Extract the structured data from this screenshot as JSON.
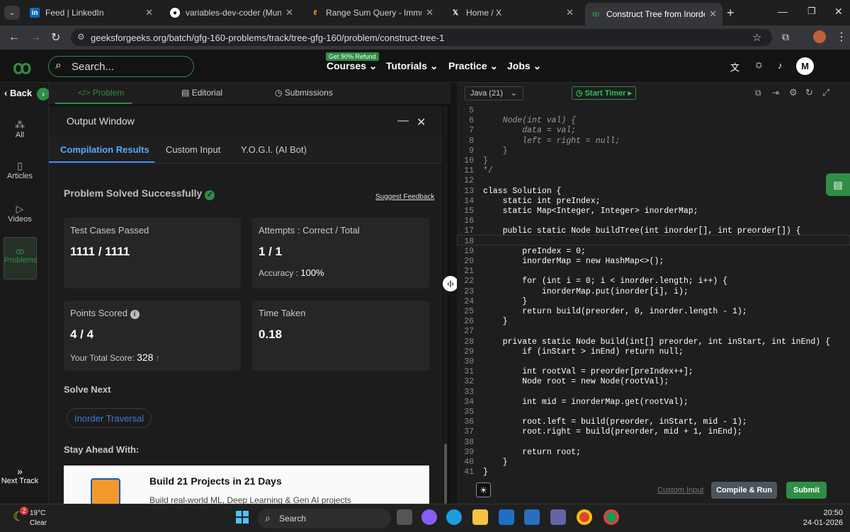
{
  "browser": {
    "tabs": [
      {
        "title": "Feed | LinkedIn",
        "fav": "in",
        "color": "#0a66c2"
      },
      {
        "title": "variables-dev-coder (Munna Az",
        "fav": "gh",
        "color": "#ffffff"
      },
      {
        "title": "Range Sum Query - Immutable",
        "fav": "lc",
        "color": "#ffa116"
      },
      {
        "title": "Home / X",
        "fav": "X",
        "color": "#000000"
      },
      {
        "title": "Construct Tree from Inorder &",
        "fav": "gfg",
        "color": "#2f8d46"
      }
    ],
    "url": "geeksforgeeks.org/batch/gfg-160-problems/track/tree-gfg-160/problem/construct-tree-1"
  },
  "header": {
    "search_placeholder": "Search...",
    "badge": "Get 90% Refund",
    "nav": [
      "Courses",
      "Tutorials",
      "Practice",
      "Jobs"
    ],
    "avatar": "M"
  },
  "rail": {
    "back": "Back",
    "items": [
      "All",
      "Articles",
      "Videos",
      "Problems"
    ],
    "next": "Next Track"
  },
  "problem_tabs": [
    "Problem",
    "Editorial",
    "Submissions"
  ],
  "output": {
    "title": "Output Window",
    "tabs": [
      "Compilation Results",
      "Custom Input",
      "Y.O.G.I. (AI Bot)"
    ],
    "status": "Problem Solved Successfully",
    "feedback": "Suggest Feedback",
    "cards": {
      "tests_label": "Test Cases Passed",
      "tests_value": "1111 / 1111",
      "attempts_label": "Attempts : Correct / Total",
      "attempts_value": "1 / 1",
      "accuracy_label": "Accuracy :",
      "accuracy_value": "100%",
      "points_label": "Points Scored",
      "points_value": "4 / 4",
      "total_label": "Your Total Score:",
      "total_value": "328",
      "time_label": "Time Taken",
      "time_value": "0.18"
    },
    "solve_next": "Solve Next",
    "next_problem": "Inorder Traversal",
    "stay_ahead": "Stay Ahead With:",
    "promo_title": "Build 21 Projects in 21 Days",
    "promo_sub": "Build real-world ML, Deep Learning & Gen AI projects"
  },
  "editor": {
    "language": "Java (21)",
    "timer": "Start Timer",
    "custom_input": "Custom Input",
    "compile": "Compile & Run",
    "submit": "Submit",
    "lines": [
      {
        "n": "5",
        "t": ""
      },
      {
        "n": "6",
        "t": "    Node(int val) {"
      },
      {
        "n": "7",
        "t": "        data = val;"
      },
      {
        "n": "8",
        "t": "        left = right = null;"
      },
      {
        "n": "9",
        "t": "    }"
      },
      {
        "n": "10",
        "t": "}"
      },
      {
        "n": "11",
        "t": "*/"
      },
      {
        "n": "12",
        "t": ""
      },
      {
        "n": "13",
        "t": "class Solution {"
      },
      {
        "n": "14",
        "t": "    static int preIndex;"
      },
      {
        "n": "15",
        "t": "    static Map<Integer, Integer> inorderMap;"
      },
      {
        "n": "16",
        "t": ""
      },
      {
        "n": "17",
        "t": "    public static Node buildTree(int inorder[], int preorder[]) {"
      },
      {
        "n": "18",
        "t": ""
      },
      {
        "n": "19",
        "t": "        preIndex = 0;"
      },
      {
        "n": "20",
        "t": "        inorderMap = new HashMap<>();"
      },
      {
        "n": "21",
        "t": ""
      },
      {
        "n": "22",
        "t": "        for (int i = 0; i < inorder.length; i++) {"
      },
      {
        "n": "23",
        "t": "            inorderMap.put(inorder[i], i);"
      },
      {
        "n": "24",
        "t": "        }"
      },
      {
        "n": "25",
        "t": "        return build(preorder, 0, inorder.length - 1);"
      },
      {
        "n": "26",
        "t": "    }"
      },
      {
        "n": "27",
        "t": ""
      },
      {
        "n": "28",
        "t": "    private static Node build(int[] preorder, int inStart, int inEnd) {"
      },
      {
        "n": "29",
        "t": "        if (inStart > inEnd) return null;"
      },
      {
        "n": "30",
        "t": ""
      },
      {
        "n": "31",
        "t": "        int rootVal = preorder[preIndex++];"
      },
      {
        "n": "32",
        "t": "        Node root = new Node(rootVal);"
      },
      {
        "n": "33",
        "t": ""
      },
      {
        "n": "34",
        "t": "        int mid = inorderMap.get(rootVal);"
      },
      {
        "n": "35",
        "t": ""
      },
      {
        "n": "36",
        "t": "        root.left = build(preorder, inStart, mid - 1);"
      },
      {
        "n": "37",
        "t": "        root.right = build(preorder, mid + 1, inEnd);"
      },
      {
        "n": "38",
        "t": ""
      },
      {
        "n": "39",
        "t": "        return root;"
      },
      {
        "n": "40",
        "t": "    }"
      },
      {
        "n": "41",
        "t": "}"
      }
    ]
  },
  "taskbar": {
    "weather_temp": "19°C",
    "weather_text": "Clear",
    "weather_badge": "2",
    "search": "Search",
    "time": "20:50",
    "date": "24-01-2026"
  }
}
